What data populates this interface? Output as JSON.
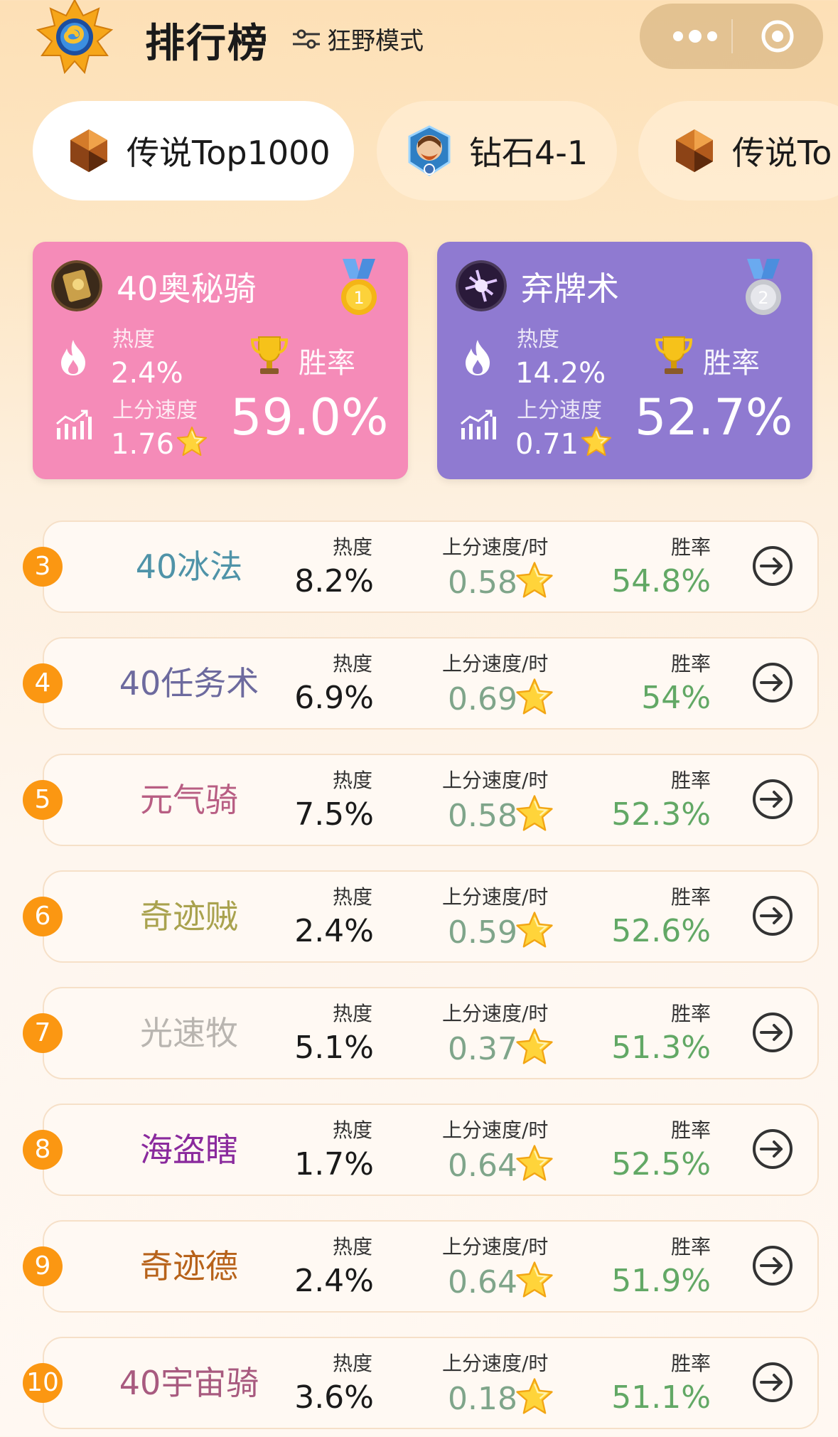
{
  "header": {
    "title": "排行榜",
    "mode_label": "狂野模式",
    "logo_icon": "hearthstone-logo",
    "menu_icon": "more-dots-icon",
    "close_icon": "target-circle-icon"
  },
  "tabs": [
    {
      "label": "传说Top1000",
      "active": true,
      "icon": "legend-rank-gem"
    },
    {
      "label": "钻石4-1",
      "active": false,
      "icon": "diamond-rank-portrait"
    },
    {
      "label": "传说To",
      "active": false,
      "icon": "legend-rank-gem"
    }
  ],
  "top_cards": [
    {
      "name": "40奥秘骑",
      "heat_label": "热度",
      "heat": "2.4%",
      "speed_label": "上分速度",
      "speed": "1.76",
      "winrate_label": "胜率",
      "winrate": "59.0%",
      "medal": "1",
      "bg_color": "#f58bb8"
    },
    {
      "name": "弃牌术",
      "heat_label": "热度",
      "heat": "14.2%",
      "speed_label": "上分速度",
      "speed": "0.71",
      "winrate_label": "胜率",
      "winrate": "52.7%",
      "medal": "2",
      "bg_color": "#8f7ad1"
    }
  ],
  "rows": [
    {
      "rank": "3",
      "name": "40冰法",
      "name_color": "#4f93a8",
      "heat_label": "热度",
      "heat": "8.2%",
      "speed_label": "上分速度/时",
      "speed": "0.58",
      "winrate_label": "胜率",
      "winrate": "54.8%"
    },
    {
      "rank": "4",
      "name": "40任务术",
      "name_color": "#6d6a9e",
      "heat_label": "热度",
      "heat": "6.9%",
      "speed_label": "上分速度/时",
      "speed": "0.69",
      "winrate_label": "胜率",
      "winrate": "54%"
    },
    {
      "rank": "5",
      "name": "元气骑",
      "name_color": "#b85e83",
      "heat_label": "热度",
      "heat": "7.5%",
      "speed_label": "上分速度/时",
      "speed": "0.58",
      "winrate_label": "胜率",
      "winrate": "52.3%"
    },
    {
      "rank": "6",
      "name": "奇迹贼",
      "name_color": "#a9a24e",
      "heat_label": "热度",
      "heat": "2.4%",
      "speed_label": "上分速度/时",
      "speed": "0.59",
      "winrate_label": "胜率",
      "winrate": "52.6%"
    },
    {
      "rank": "7",
      "name": "光速牧",
      "name_color": "#b9b5b0",
      "heat_label": "热度",
      "heat": "5.1%",
      "speed_label": "上分速度/时",
      "speed": "0.37",
      "winrate_label": "胜率",
      "winrate": "51.3%"
    },
    {
      "rank": "8",
      "name": "海盗瞎",
      "name_color": "#8a2a9d",
      "heat_label": "热度",
      "heat": "1.7%",
      "speed_label": "上分速度/时",
      "speed": "0.64",
      "winrate_label": "胜率",
      "winrate": "52.5%"
    },
    {
      "rank": "9",
      "name": "奇迹德",
      "name_color": "#b7621a",
      "heat_label": "热度",
      "heat": "2.4%",
      "speed_label": "上分速度/时",
      "speed": "0.64",
      "winrate_label": "胜率",
      "winrate": "51.9%"
    },
    {
      "rank": "10",
      "name": "40宇宙骑",
      "name_color": "#a85a7f",
      "heat_label": "热度",
      "heat": "3.6%",
      "speed_label": "上分速度/时",
      "speed": "0.18",
      "winrate_label": "胜率",
      "winrate": "51.1%"
    }
  ],
  "colors": {
    "rank_badge": "#fb9712",
    "speed_value": "#7fa58a",
    "winrate_value": "#62a865"
  }
}
